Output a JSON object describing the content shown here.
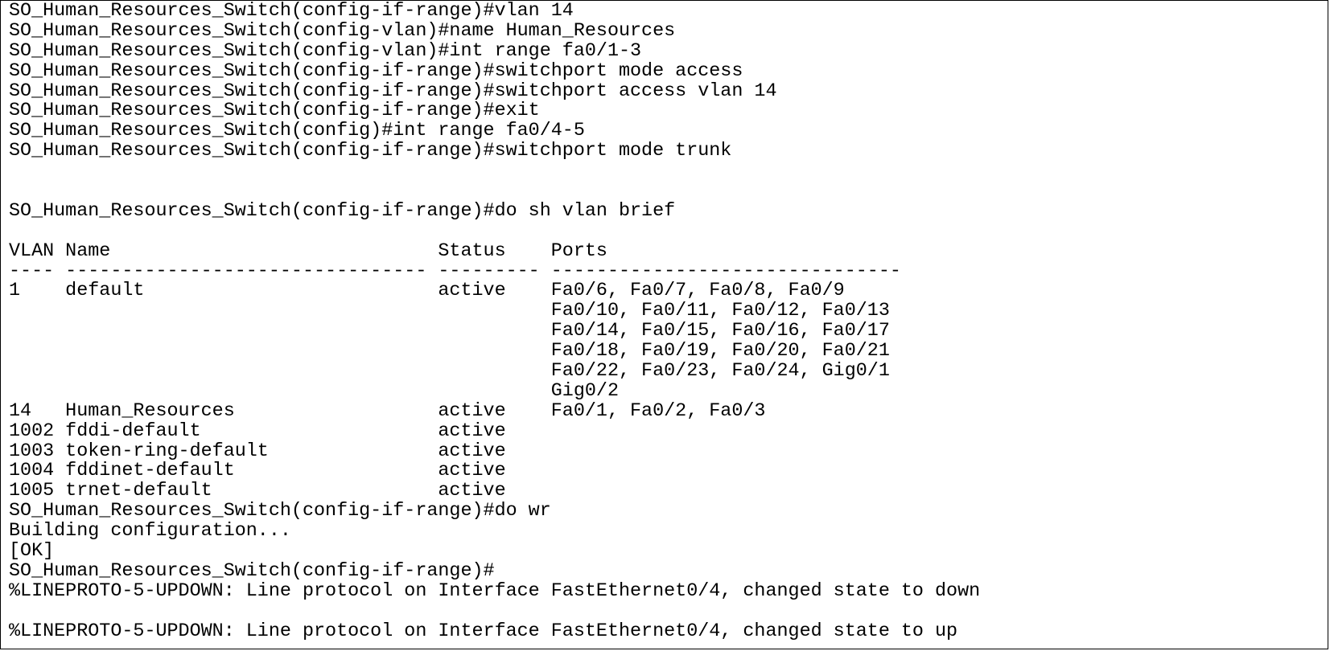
{
  "terminal": {
    "lines": [
      "SO_Human_Resources_Switch(config-if-range)#vlan 14",
      "SO_Human_Resources_Switch(config-vlan)#name Human_Resources",
      "SO_Human_Resources_Switch(config-vlan)#int range fa0/1-3",
      "SO_Human_Resources_Switch(config-if-range)#switchport mode access",
      "SO_Human_Resources_Switch(config-if-range)#switchport access vlan 14",
      "SO_Human_Resources_Switch(config-if-range)#exit",
      "SO_Human_Resources_Switch(config)#int range fa0/4-5",
      "SO_Human_Resources_Switch(config-if-range)#switchport mode trunk",
      "",
      "",
      "SO_Human_Resources_Switch(config-if-range)#do sh vlan brief",
      "",
      "VLAN Name                             Status    Ports",
      "---- -------------------------------- --------- -------------------------------",
      "1    default                          active    Fa0/6, Fa0/7, Fa0/8, Fa0/9",
      "                                                Fa0/10, Fa0/11, Fa0/12, Fa0/13",
      "                                                Fa0/14, Fa0/15, Fa0/16, Fa0/17",
      "                                                Fa0/18, Fa0/19, Fa0/20, Fa0/21",
      "                                                Fa0/22, Fa0/23, Fa0/24, Gig0/1",
      "                                                Gig0/2",
      "14   Human_Resources                  active    Fa0/1, Fa0/2, Fa0/3",
      "1002 fddi-default                     active",
      "1003 token-ring-default               active",
      "1004 fddinet-default                  active",
      "1005 trnet-default                    active",
      "SO_Human_Resources_Switch(config-if-range)#do wr",
      "Building configuration...",
      "[OK]",
      "SO_Human_Resources_Switch(config-if-range)#",
      "%LINEPROTO-5-UPDOWN: Line protocol on Interface FastEthernet0/4, changed state to down",
      "",
      "%LINEPROTO-5-UPDOWN: Line protocol on Interface FastEthernet0/4, changed state to up"
    ]
  }
}
